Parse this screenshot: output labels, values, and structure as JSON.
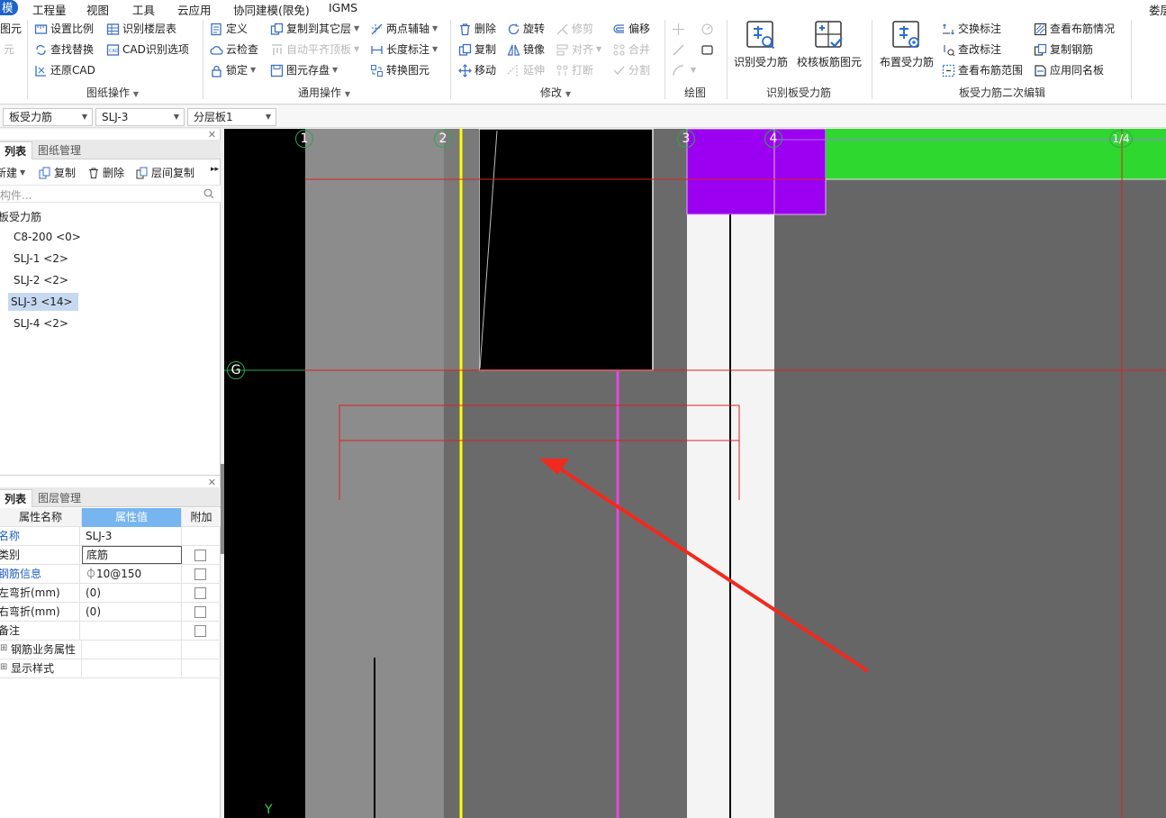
{
  "menu": {
    "active": "模",
    "items": [
      "工程量",
      "视图",
      "工具",
      "云应用",
      "协同建模(限免)",
      "IGMS"
    ],
    "right": "娄层"
  },
  "ribbon": {
    "cut_left": [
      "图元",
      "元"
    ],
    "drawing_ops": {
      "buttons": [
        "设置比例",
        "查找替换",
        "还原CAD",
        "识别楼层表",
        "CAD识别选项"
      ],
      "label": "图纸操作"
    },
    "general_ops": {
      "buttons": [
        "定义",
        "云检查",
        "锁定",
        "复制到其它层",
        "自动平齐顶板",
        "图元存盘",
        "两点辅轴",
        "长度标注",
        "转换图元"
      ],
      "label": "通用操作"
    },
    "modify": {
      "buttons": [
        "删除",
        "复制",
        "移动",
        "旋转",
        "镜像",
        "延伸",
        "修剪",
        "对齐",
        "打断",
        "偏移",
        "合并",
        "分割"
      ],
      "label": "修改"
    },
    "draw": {
      "label": "绘图"
    },
    "recognize": {
      "buttons": [
        "识别受力筋",
        "校核板筋图元"
      ],
      "label": "识别板受力筋"
    },
    "secondary": {
      "big": "布置受力筋",
      "buttons": [
        "交换标注",
        "查改标注",
        "查看布筋范围",
        "查看布筋情况",
        "复制钢筋",
        "应用同名板"
      ],
      "label": "板受力筋二次编辑"
    }
  },
  "selectors": [
    "板受力筋",
    "SLJ-3",
    "分层板1"
  ],
  "component_panel": {
    "tabs": [
      "列表",
      "图纸管理"
    ],
    "toolbar": [
      "新建",
      "复制",
      "删除",
      "层间复制"
    ],
    "search_placeholder": "构件...",
    "root": "板受力筋",
    "items": [
      "C8-200 <0>",
      "SLJ-1 <2>",
      "SLJ-2 <2>",
      "SLJ-3 <14>",
      "SLJ-4 <2>"
    ],
    "selected_index": 3
  },
  "property_panel": {
    "tabs": [
      "列表",
      "图层管理"
    ],
    "headers": [
      "属性名称",
      "属性值",
      "附加"
    ],
    "rows": [
      {
        "name": "名称",
        "value": "SLJ-3",
        "blue": true,
        "check": false
      },
      {
        "name": "类别",
        "value": "底筋",
        "blue": false,
        "check": true
      },
      {
        "name": "钢筋信息",
        "value": "⏀10@150",
        "blue": true,
        "check": true
      },
      {
        "name": "左弯折(mm)",
        "value": "(0)",
        "blue": false,
        "check": true
      },
      {
        "name": "右弯折(mm)",
        "value": "(0)",
        "blue": false,
        "check": true
      },
      {
        "name": "备注",
        "value": "",
        "blue": false,
        "check": true
      },
      {
        "name": "钢筋业务属性",
        "value": "",
        "blue": false,
        "check": false,
        "expand": true
      },
      {
        "name": "显示样式",
        "value": "",
        "blue": false,
        "check": false,
        "expand": true
      }
    ]
  },
  "canvas": {
    "axis_labels": [
      "1",
      "2",
      "3",
      "4",
      "1/4",
      "G"
    ],
    "y_label": "Y",
    "colors": {
      "background": "#666666",
      "purple": "#9b00f0",
      "green": "#2ed82e",
      "axis_red": "#e02020",
      "yellow": "#ffff00",
      "magenta": "#ff40ff",
      "arrow": "#f02a1e"
    }
  }
}
